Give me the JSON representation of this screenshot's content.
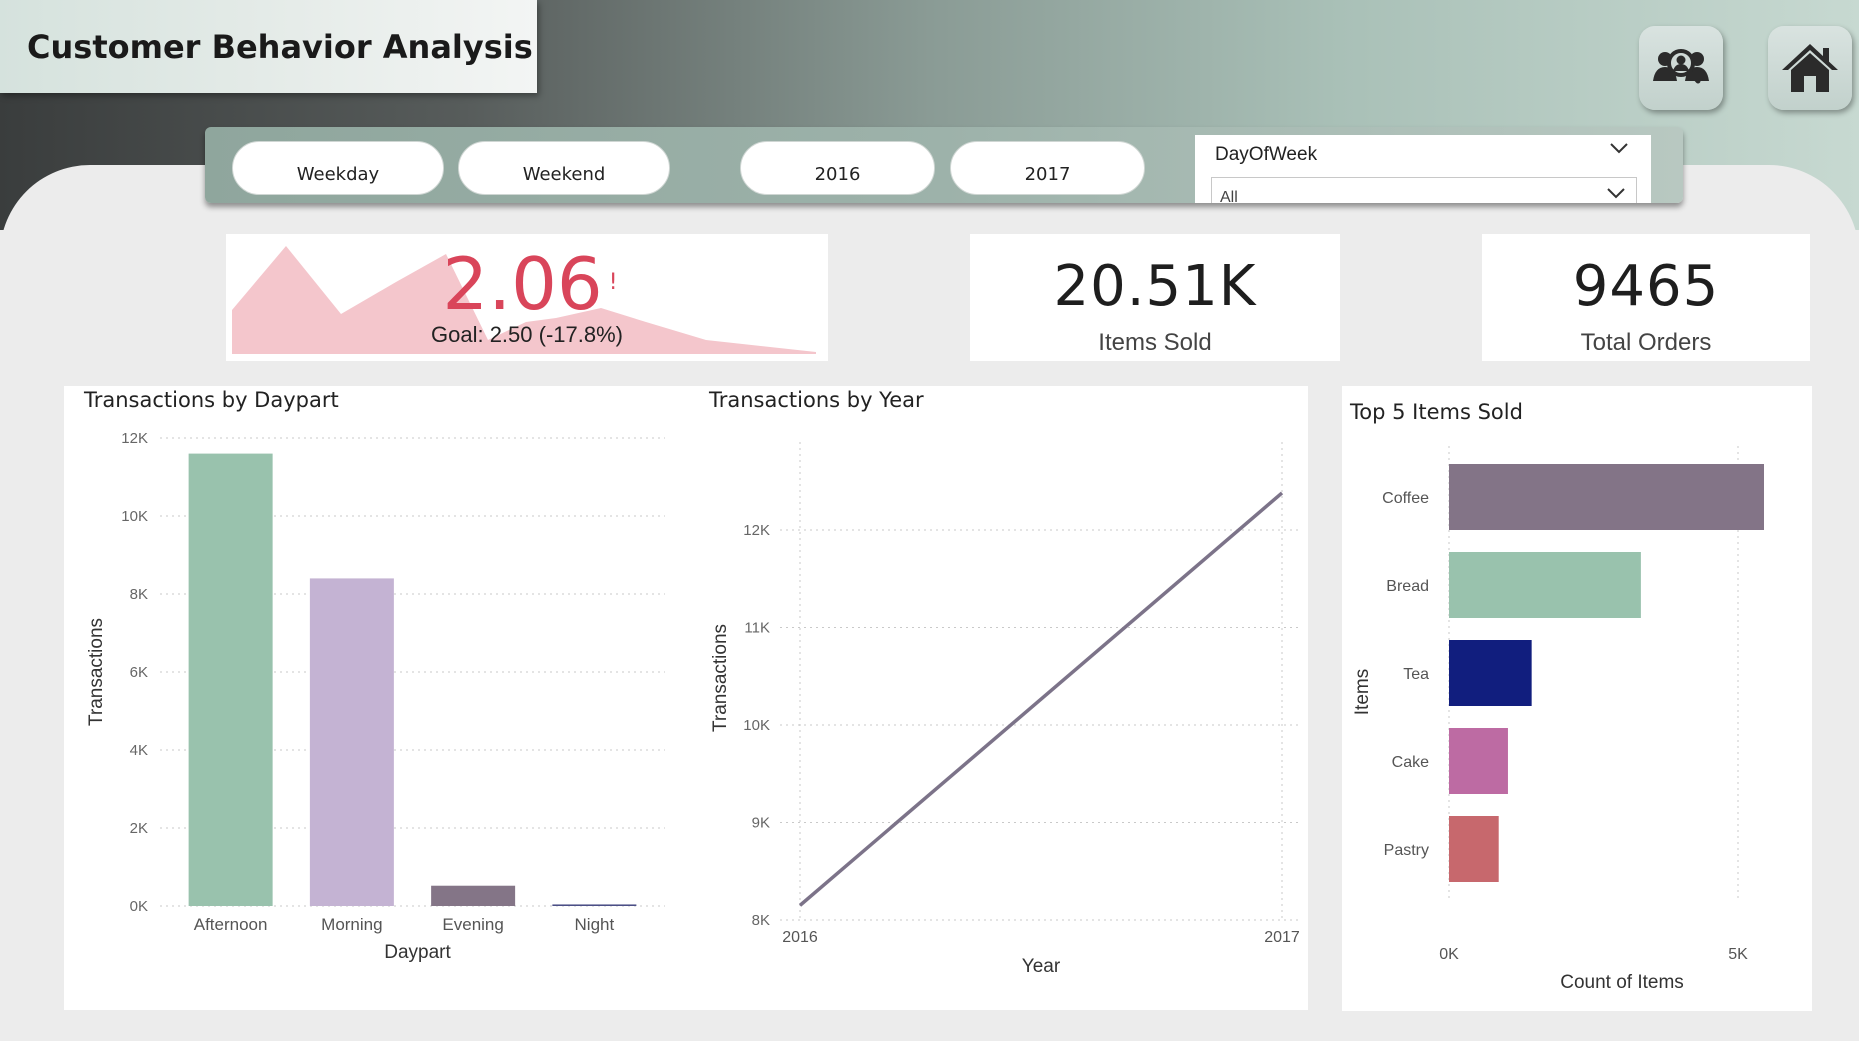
{
  "header": {
    "title": "Customer Behavior Analysis",
    "customers_icon": "customers-search-icon",
    "home_icon": "home-icon"
  },
  "filters": {
    "daytype_buttons": [
      "Weekday",
      "Weekend"
    ],
    "year_buttons": [
      "2016",
      "2017"
    ],
    "dropdown_label": "DayOfWeek",
    "dropdown_value": "All"
  },
  "kpis": {
    "gauge_value": "2.06",
    "gauge_alert": "!",
    "gauge_goal": "Goal: 2.50 (-17.8%)",
    "items_sold_value": "20.51K",
    "items_sold_label": "Items Sold",
    "total_orders_value": "9465",
    "total_orders_label": "Total Orders"
  },
  "colors": {
    "alert_red": "#d9455a",
    "sparkline_fill": "#f4c6cc",
    "afternoon": "#99c2ad",
    "morning": "#c4b3d3",
    "evening": "#847587",
    "night": "#4b4f86",
    "line": "#7c7389",
    "coffee": "#837487",
    "bread": "#99c2ad",
    "tea": "#111e7e",
    "cake": "#bd6ba3",
    "pastry": "#c7686d"
  },
  "chart_data": [
    {
      "type": "bar",
      "title": "Transactions by Daypart",
      "xlabel": "Daypart",
      "ylabel": "Transactions",
      "categories": [
        "Afternoon",
        "Morning",
        "Evening",
        "Night"
      ],
      "values": [
        11600,
        8400,
        520,
        40
      ],
      "ylim": [
        0,
        12000
      ],
      "yticks": [
        "0K",
        "2K",
        "4K",
        "6K",
        "8K",
        "10K",
        "12K"
      ],
      "grid": true
    },
    {
      "type": "line",
      "title": "Transactions by Year",
      "xlabel": "Year",
      "ylabel": "Transactions",
      "x": [
        "2016",
        "2017"
      ],
      "values": [
        8150,
        12380
      ],
      "ylim": [
        8000,
        12400
      ],
      "yticks": [
        "8K",
        "9K",
        "10K",
        "11K",
        "12K"
      ],
      "grid": true
    },
    {
      "type": "bar",
      "orientation": "horizontal",
      "title": "Top 5 Items Sold",
      "xlabel": "Count of Items",
      "ylabel": "Items",
      "categories": [
        "Coffee",
        "Bread",
        "Tea",
        "Cake",
        "Pastry"
      ],
      "values": [
        5450,
        3320,
        1430,
        1020,
        860
      ],
      "xlim": [
        0,
        5450
      ],
      "xticks": [
        "0K",
        "5K"
      ],
      "grid": true
    }
  ]
}
